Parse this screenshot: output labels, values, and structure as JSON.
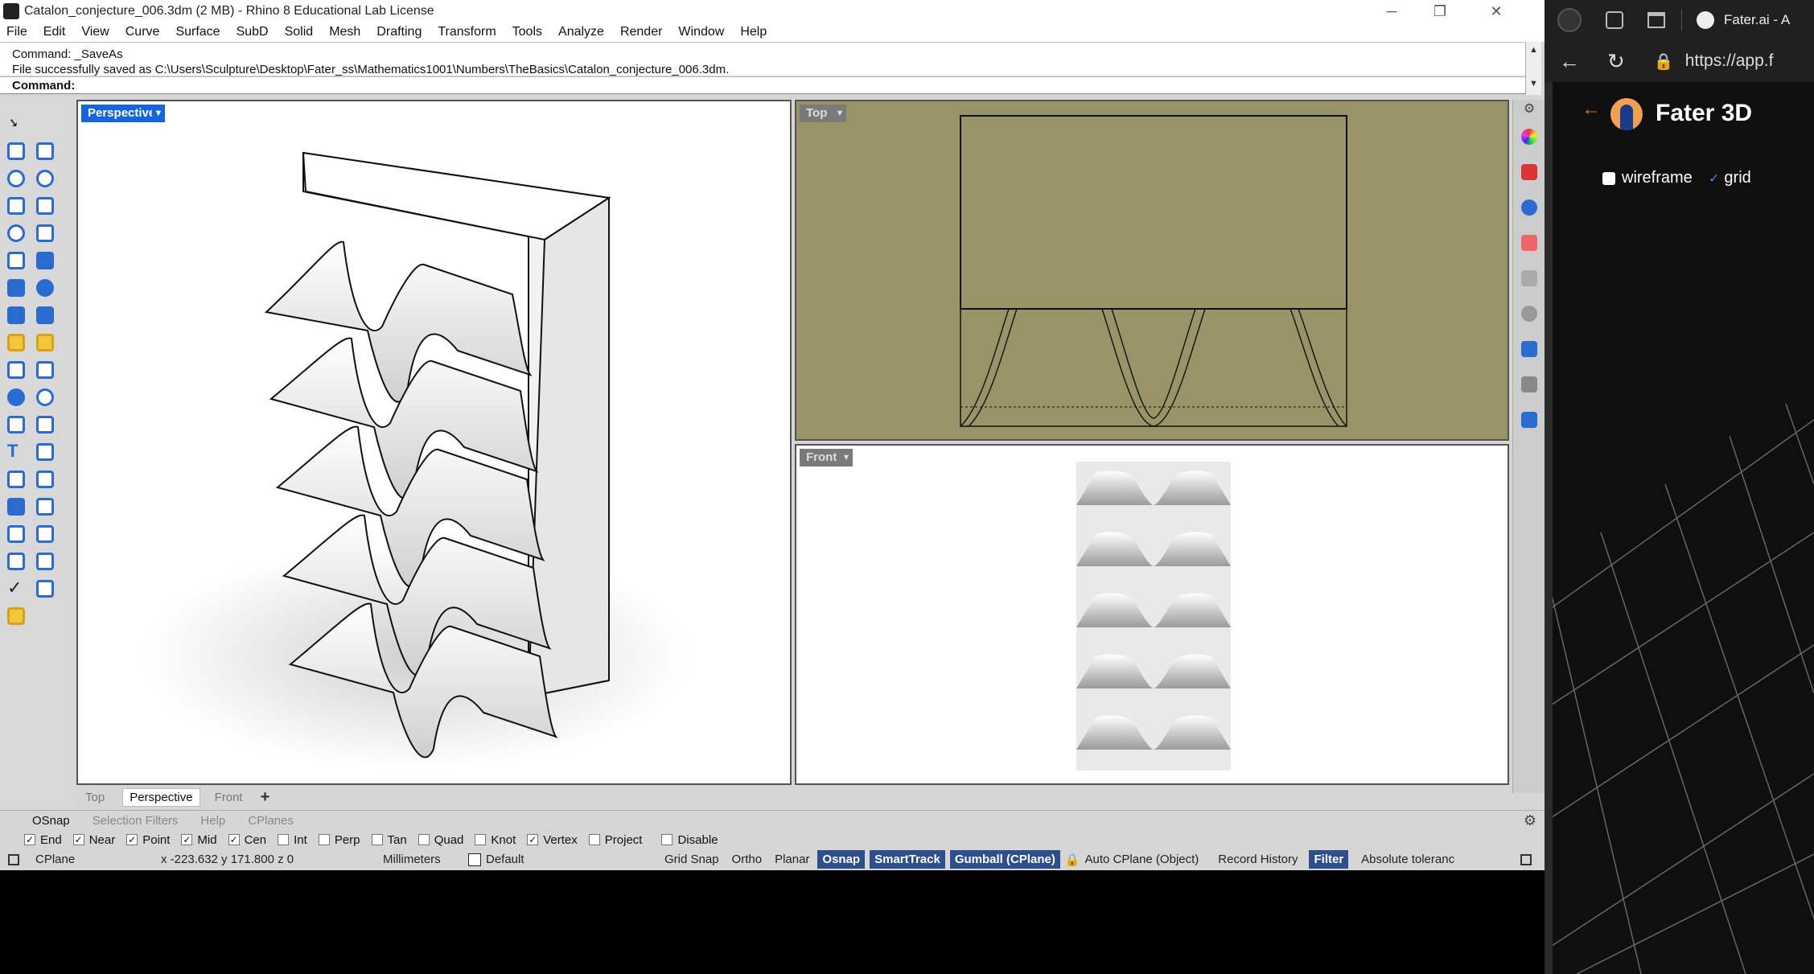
{
  "window": {
    "title": "Catalon_conjecture_006.3dm (2 MB) - Rhino 8 Educational Lab License",
    "controls": [
      "─",
      "❐",
      "✕"
    ]
  },
  "menu": [
    "File",
    "Edit",
    "View",
    "Curve",
    "Surface",
    "SubD",
    "Solid",
    "Mesh",
    "Drafting",
    "Transform",
    "Tools",
    "Analyze",
    "Render",
    "Window",
    "Help"
  ],
  "command": {
    "history": [
      "Command: _SaveAs",
      "File successfully saved as C:\\Users\\Sculpture\\Desktop\\Fater_ss\\Mathematics1001\\Numbers\\TheBasics\\Catalon_conjecture_006.3dm."
    ],
    "prompt": "Command:"
  },
  "viewports": {
    "perspective": {
      "label": "Perspective"
    },
    "top": {
      "label": "Top"
    },
    "front": {
      "label": "Front"
    }
  },
  "viewport_tabs": [
    "Top",
    "Perspective",
    "Front",
    "+"
  ],
  "osnap_tabs": [
    "OSnap",
    "Selection Filters",
    "Help",
    "CPlanes"
  ],
  "osnaps": [
    {
      "label": "End",
      "checked": true
    },
    {
      "label": "Near",
      "checked": true
    },
    {
      "label": "Point",
      "checked": true
    },
    {
      "label": "Mid",
      "checked": true
    },
    {
      "label": "Cen",
      "checked": true
    },
    {
      "label": "Int",
      "checked": false
    },
    {
      "label": "Perp",
      "checked": false
    },
    {
      "label": "Tan",
      "checked": false
    },
    {
      "label": "Quad",
      "checked": false
    },
    {
      "label": "Knot",
      "checked": false
    },
    {
      "label": "Vertex",
      "checked": true
    },
    {
      "label": "Project",
      "checked": false
    },
    {
      "label": "Disable",
      "checked": false
    }
  ],
  "status": {
    "cplane": "CPlane",
    "coords": "x -223.632  y 171.800  z 0",
    "units": "Millimeters",
    "layer": "Default",
    "toggles": [
      "Grid Snap",
      "Ortho",
      "Planar"
    ],
    "active": [
      "Osnap",
      "SmartTrack",
      "Gumball (CPlane)"
    ],
    "auto_cplane": "Auto CPlane (Object)",
    "record_history": "Record History",
    "filter": "Filter",
    "tolerance": "Absolute toleranc"
  },
  "browser": {
    "tab_title": "Fater.ai - A",
    "url": "https://app.f",
    "app_name": "Fater 3D",
    "options": [
      {
        "label": "wireframe",
        "checked": false
      },
      {
        "label": "grid",
        "checked": true
      }
    ]
  },
  "colors": {
    "top_viewport_bg": "#989468",
    "active_tab": "#1565e0",
    "status_active": "#2d4f8e"
  }
}
